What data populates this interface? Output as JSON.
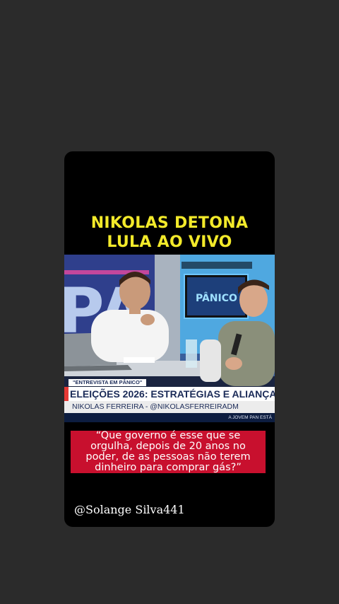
{
  "headline": {
    "line1": "NIKOLAS DETONA",
    "line2": "LULA AO VIVO"
  },
  "video": {
    "tag": "\"ENTREVISTA EM PÂNICO\"",
    "title": "ELEIÇÕES 2026: ESTRATÉGIAS E ALIANÇA",
    "subtitle": "NIKOLAS FERREIRA - @NIKOLASFERREIRADM",
    "footer": "A JOVEM PAN ESTÁ"
  },
  "quote": {
    "line1": "“Que governo é esse que se",
    "line2": "orgulha, depois de 20 anos no",
    "line3": "poder, de as pessoas não terem",
    "line4": "dinheiro para comprar gás?”"
  },
  "credit": "@Solange Silva441",
  "colors": {
    "background": "#2b2b2b",
    "headline": "#f3ea2a",
    "quote_box": "#c8102e"
  }
}
